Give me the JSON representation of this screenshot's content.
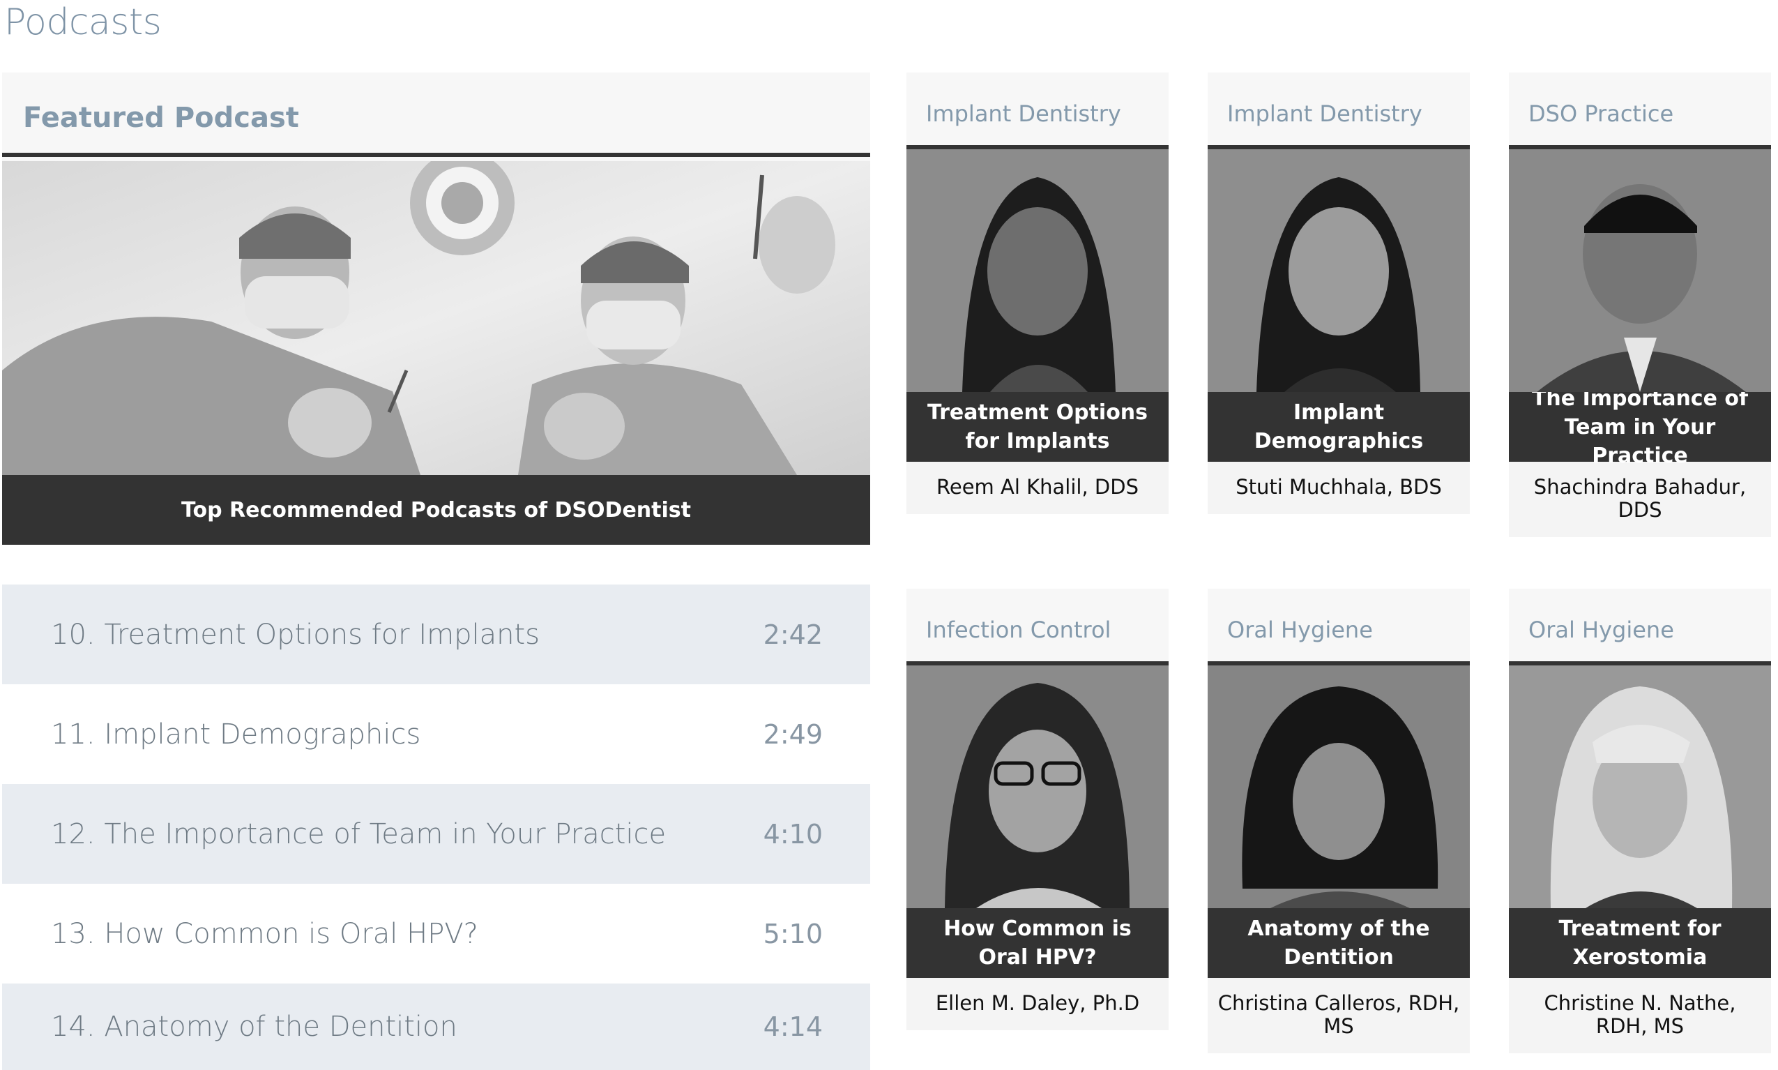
{
  "page": {
    "title": "Podcasts"
  },
  "featured": {
    "header": "Featured Podcast",
    "caption": "Top Recommended Podcasts of DSODentist"
  },
  "episodes": [
    {
      "title": "10. Treatment Options for Implants",
      "duration": "2:42"
    },
    {
      "title": "11. Implant Demographics",
      "duration": "2:49"
    },
    {
      "title": "12. The Importance of Team in Your Practice",
      "duration": "4:10"
    },
    {
      "title": "13. How Common is Oral HPV?",
      "duration": "5:10"
    },
    {
      "title": "14. Anatomy of the Dentition",
      "duration": "4:14"
    }
  ],
  "cards": [
    {
      "category": "Implant Dentistry",
      "title": "Treatment Options for Implants",
      "speaker": "Reem Al Khalil, DDS"
    },
    {
      "category": "Implant Dentistry",
      "title": "Implant Demographics",
      "speaker": "Stuti Muchhala, BDS"
    },
    {
      "category": "DSO Practice",
      "title": "The Importance of Team in Your Practice",
      "speaker": "Shachindra Bahadur, DDS"
    },
    {
      "category": "Infection Control",
      "title": "How Common is Oral HPV?",
      "speaker": "Ellen M. Daley, Ph.D"
    },
    {
      "category": "Oral Hygiene",
      "title": "Anatomy of the Dentition",
      "speaker": "Christina Calleros, RDH, MS"
    },
    {
      "category": "Oral Hygiene",
      "title": "Treatment for Xerostomia",
      "speaker": "Christine N. Nathe, RDH, MS"
    }
  ]
}
